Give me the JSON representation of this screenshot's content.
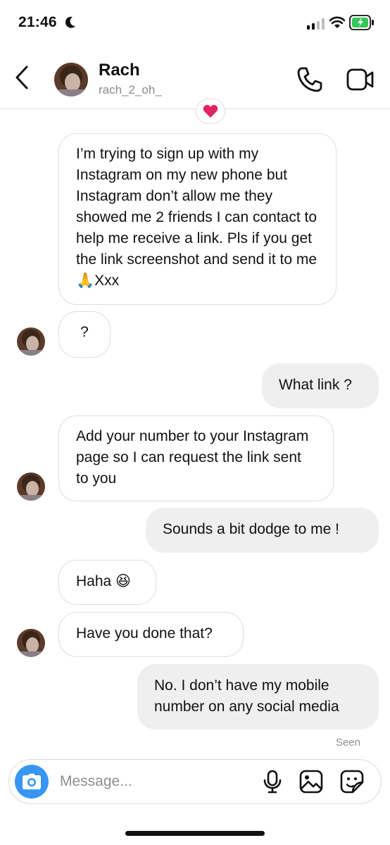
{
  "status_bar": {
    "time": "21:46"
  },
  "header": {
    "name": "Rach",
    "username": "rach_2_oh_"
  },
  "messages": {
    "m1": "I’m trying  to sign up with my Instagram on my new phone but Instagram don’t allow me they showed me 2 friends I can contact to help me receive a link. Pls if you get the link screenshot and send it to me 🙏Xxx",
    "m2": "?",
    "m3": "What link ?",
    "m4": "Add your number to your Instagram page so I can request the link sent to you",
    "m5": "Sounds a bit dodge to me !",
    "m6": "Haha 😆",
    "m7": "Have you done that?",
    "m8": "No. I don’t have my mobile number on any social media"
  },
  "seen_label": "Seen",
  "composer": {
    "placeholder": "Message..."
  },
  "colors": {
    "accent": "#3797f0",
    "incoming_border": "#dedede",
    "outgoing_bg": "#efefef",
    "heart": "#e0245e"
  },
  "icons": [
    "moon-icon",
    "signal-icon",
    "wifi-icon",
    "battery-icon",
    "back-icon",
    "phone-icon",
    "video-icon",
    "heart-icon",
    "camera-icon",
    "mic-icon",
    "gallery-icon",
    "sticker-icon"
  ]
}
